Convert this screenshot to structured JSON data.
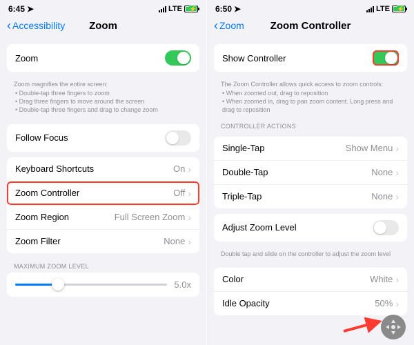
{
  "left": {
    "status": {
      "time": "6:45",
      "net": "LTE"
    },
    "nav": {
      "back": "Accessibility",
      "title": "Zoom"
    },
    "zoom_row": {
      "label": "Zoom",
      "on": true
    },
    "help": {
      "lead": "Zoom magnifies the entire screen:",
      "b1": "Double-tap three fingers to zoom",
      "b2": "Drag three fingers to move around the screen",
      "b3": "Double-tap three fingers and drag to change zoom"
    },
    "follow_focus": {
      "label": "Follow Focus",
      "on": false
    },
    "keyboard": {
      "label": "Keyboard Shortcuts",
      "value": "On"
    },
    "controller": {
      "label": "Zoom Controller",
      "value": "Off"
    },
    "region": {
      "label": "Zoom Region",
      "value": "Full Screen Zoom"
    },
    "filter": {
      "label": "Zoom Filter",
      "value": "None"
    },
    "max_header": "MAXIMUM ZOOM LEVEL",
    "max_value": "5.0x"
  },
  "right": {
    "status": {
      "time": "6:50",
      "net": "LTE"
    },
    "nav": {
      "back": "Zoom",
      "title": "Zoom Controller"
    },
    "show": {
      "label": "Show Controller",
      "on": true
    },
    "help": {
      "lead": "The Zoom Controller allows quick access to zoom controls:",
      "b1": "When zoomed out, drag to reposition",
      "b2": "When zoomed in, drag to pan zoom content. Long press and drag to reposition"
    },
    "actions_header": "CONTROLLER ACTIONS",
    "single": {
      "label": "Single-Tap",
      "value": "Show Menu"
    },
    "double": {
      "label": "Double-Tap",
      "value": "None"
    },
    "triple": {
      "label": "Triple-Tap",
      "value": "None"
    },
    "adjust": {
      "label": "Adjust Zoom Level",
      "on": false
    },
    "adjust_help": "Double tap and slide on the controller to adjust the zoom level",
    "color": {
      "label": "Color",
      "value": "White"
    },
    "opacity": {
      "label": "Idle Opacity",
      "value": "50%"
    }
  }
}
